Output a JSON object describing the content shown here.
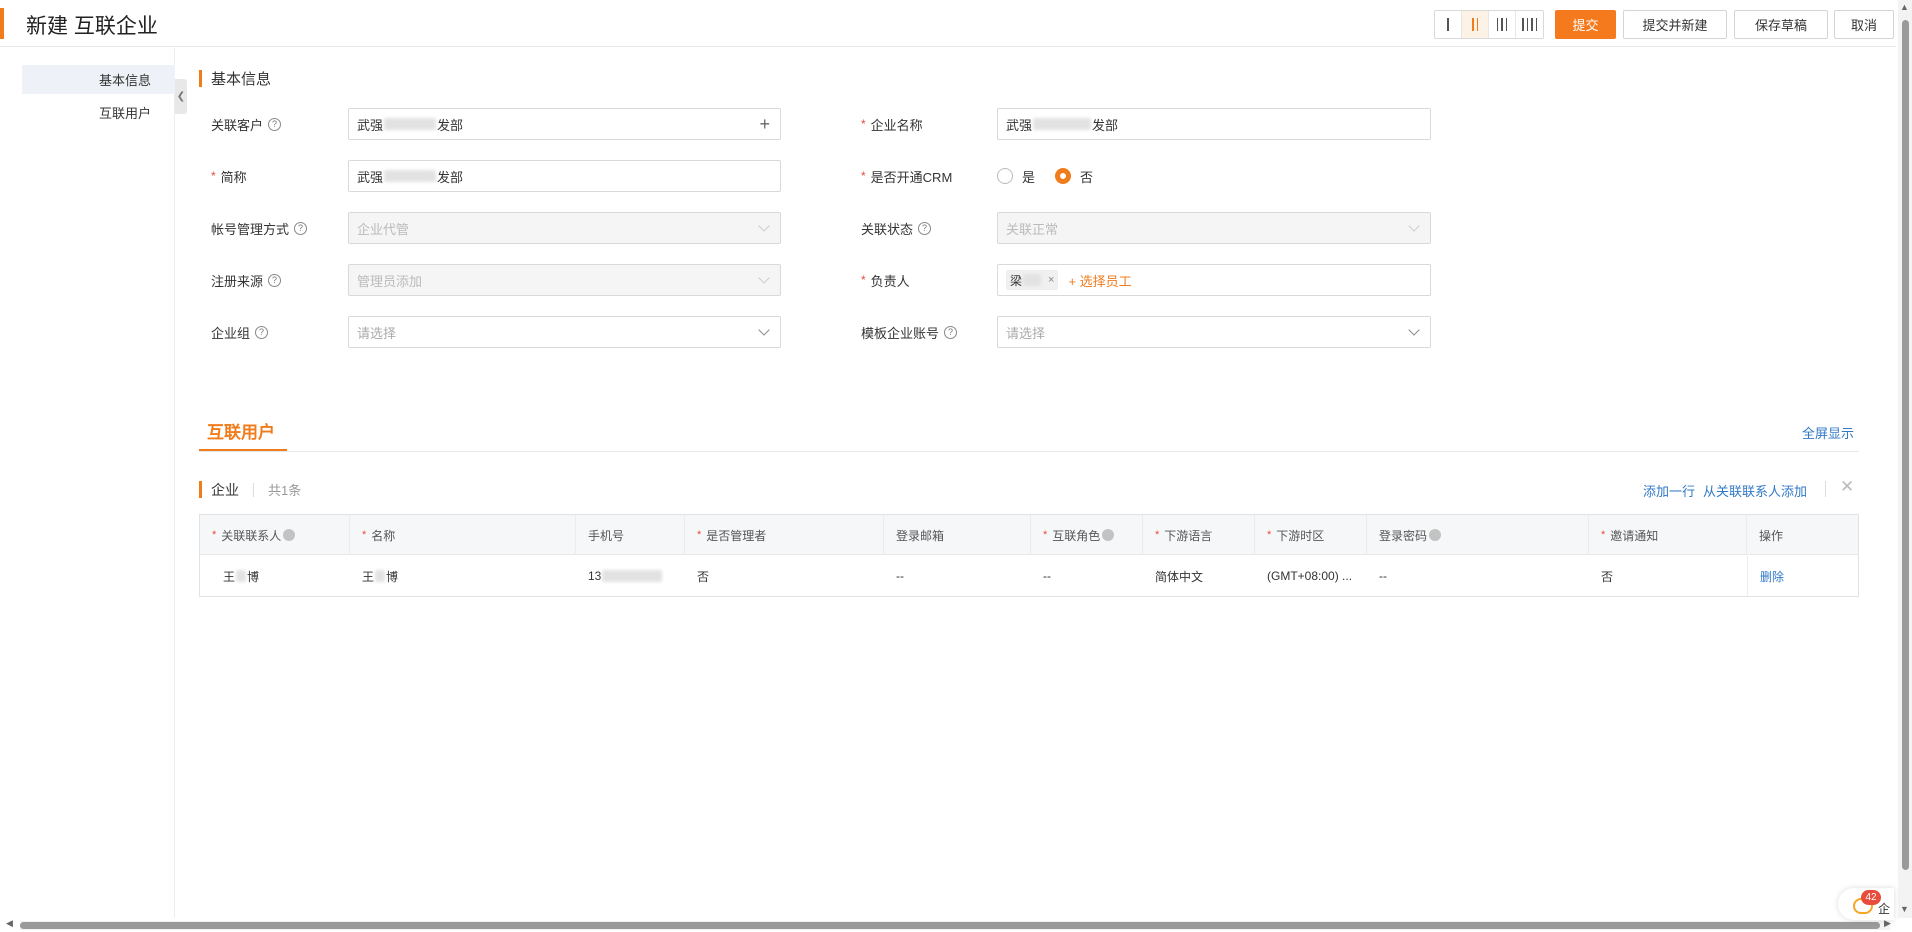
{
  "header": {
    "title": "新建 互联企业",
    "buttons": {
      "submit": "提交",
      "submit_new": "提交并新建",
      "save_draft": "保存草稿",
      "cancel": "取消"
    },
    "layout_options": [
      "1-column-layout-icon",
      "2-column-layout-icon",
      "3-column-layout-icon",
      "4-column-layout-icon"
    ],
    "active_layout": "2-column-layout-icon"
  },
  "sidebar": {
    "items": [
      {
        "label": "基本信息",
        "active": true
      },
      {
        "label": "互联用户",
        "active": false
      }
    ]
  },
  "basic_section": {
    "title": "基本信息",
    "fields": {
      "linked_customer": {
        "label": "关联客户",
        "value_prefix": "武强",
        "value_suffix": "发部"
      },
      "company_name": {
        "label": "企业名称",
        "value_prefix": "武强",
        "value_suffix": "发部"
      },
      "short_name": {
        "label": "简称",
        "value_prefix": "武强",
        "value_suffix": "发部"
      },
      "crm_enabled": {
        "label": "是否开通CRM",
        "options": [
          "是",
          "否"
        ],
        "selected": "否"
      },
      "account_mode": {
        "label": "帐号管理方式",
        "value": "企业代管"
      },
      "link_status": {
        "label": "关联状态",
        "value": "关联正常"
      },
      "register_source": {
        "label": "注册来源",
        "value": "管理员添加"
      },
      "owner": {
        "label": "负责人",
        "tag": "梁",
        "pick": "+ 选择员工"
      },
      "company_group": {
        "label": "企业组",
        "placeholder": "请选择"
      },
      "template_account": {
        "label": "模板企业账号",
        "placeholder": "请选择"
      }
    }
  },
  "users_section": {
    "tab": "互联用户",
    "fullscreen": "全屏显示",
    "table_title": "企业",
    "count": "共1条",
    "add_row": "添加一行",
    "add_from_contacts": "从关联联系人添加",
    "columns": [
      {
        "label": "关联联系人",
        "required": true,
        "help": true
      },
      {
        "label": "名称",
        "required": true,
        "help": false
      },
      {
        "label": "手机号",
        "required": false,
        "help": false
      },
      {
        "label": "是否管理者",
        "required": true,
        "help": false
      },
      {
        "label": "登录邮箱",
        "required": false,
        "help": false
      },
      {
        "label": "互联角色",
        "required": true,
        "help": true
      },
      {
        "label": "下游语言",
        "required": true,
        "help": false
      },
      {
        "label": "下游时区",
        "required": true,
        "help": false
      },
      {
        "label": "登录密码",
        "required": false,
        "help": true
      },
      {
        "label": "邀请通知",
        "required": true,
        "help": false
      },
      {
        "label": "操作",
        "required": false,
        "help": false
      }
    ],
    "rows": [
      {
        "contact_prefix": "王",
        "contact_suffix": "博",
        "name_prefix": "王",
        "name_suffix": "博",
        "phone_prefix": "13",
        "is_admin": "否",
        "email": "--",
        "role": "--",
        "language": "简体中文",
        "timezone": "(GMT+08:00) ...",
        "password": "--",
        "invite": "否",
        "action": "删除"
      }
    ]
  },
  "float_widget": {
    "badge": "42",
    "label": "企"
  },
  "colors": {
    "accent": "#f07c1c",
    "link": "#3178c6",
    "required": "#e74c3c"
  }
}
